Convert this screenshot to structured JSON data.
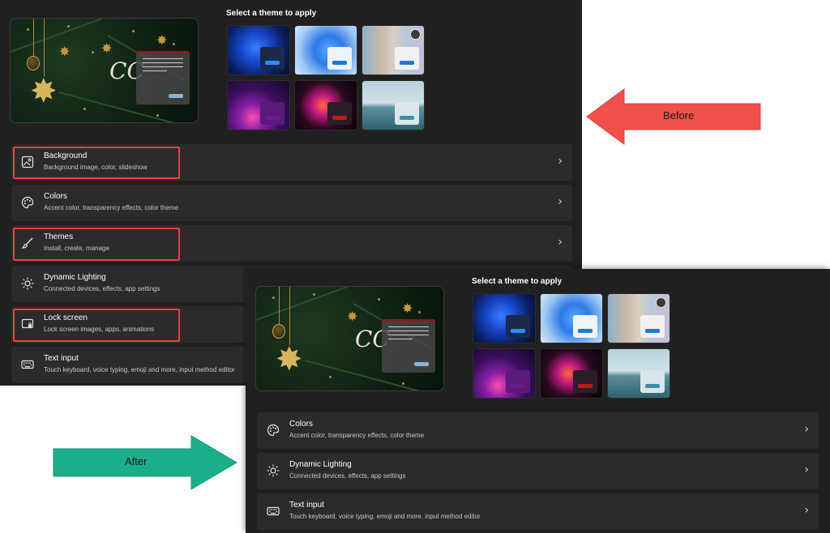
{
  "section_title": "Select a theme to apply",
  "preview": {
    "script_text": "CC"
  },
  "themes": [
    {
      "name": "theme-thumb-1"
    },
    {
      "name": "theme-thumb-2"
    },
    {
      "name": "theme-thumb-3"
    },
    {
      "name": "theme-thumb-4"
    },
    {
      "name": "theme-thumb-5"
    },
    {
      "name": "theme-thumb-6"
    }
  ],
  "before_rows": {
    "background": {
      "title": "Background",
      "sub": "Background image, color, slideshow",
      "icon": "image-icon"
    },
    "colors": {
      "title": "Colors",
      "sub": "Accent color, transparency effects, color theme",
      "icon": "palette-icon"
    },
    "themes": {
      "title": "Themes",
      "sub": "Install, create, manage",
      "icon": "brush-icon"
    },
    "dynamic_lighting": {
      "title": "Dynamic Lighting",
      "sub": "Connected devices, effects, app settings",
      "icon": "sun-icon"
    },
    "lock_screen": {
      "title": "Lock screen",
      "sub": "Lock screen images, apps, animations",
      "icon": "lock-screen-icon"
    },
    "text_input": {
      "title": "Text input",
      "sub": "Touch keyboard, voice typing, emoji and more, input method editor",
      "icon": "keyboard-icon"
    }
  },
  "after_rows": {
    "colors": {
      "title": "Colors",
      "sub": "Accent color, transparency effects, color theme",
      "icon": "palette-icon"
    },
    "dynamic_lighting": {
      "title": "Dynamic Lighting",
      "sub": "Connected devices, effects, app settings",
      "icon": "sun-icon"
    },
    "text_input": {
      "title": "Text input",
      "sub": "Touch keyboard, voice typing, emoji and more, input method editor",
      "icon": "keyboard-icon"
    }
  },
  "annotations": {
    "before_label": "Before",
    "after_label": "After",
    "before_color": "#f0504a",
    "after_color": "#1aaf8a",
    "highlight_color": "#e8403c"
  },
  "colors": {
    "window_bg": "#202020",
    "card_bg": "#2b2b2b"
  }
}
